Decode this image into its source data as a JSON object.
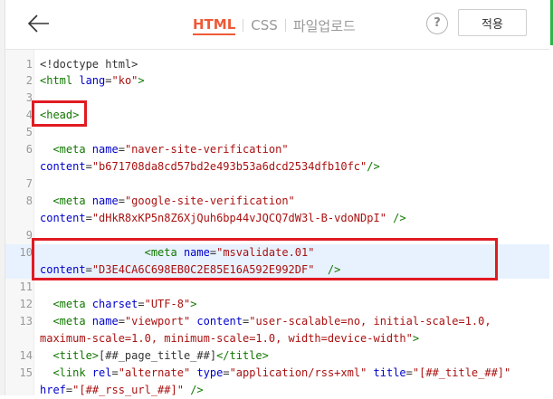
{
  "header": {
    "tabs": [
      {
        "label": "HTML",
        "active": true
      },
      {
        "label": "CSS",
        "active": false
      },
      {
        "label": "파일업로드",
        "active": false
      }
    ],
    "help_label": "?",
    "apply_label": "적용"
  },
  "editor": {
    "line_numbers": [
      "1",
      "2",
      "3",
      "4",
      "5",
      "6",
      "7",
      "8",
      "9",
      "10",
      "11",
      "12",
      "13",
      "14",
      "15"
    ],
    "code": {
      "l1": "<!doctype html>",
      "l2_open": "<html ",
      "l2_attr": "lang",
      "l2_eq": "=",
      "l2_val": "\"ko\"",
      "l2_close": ">",
      "l4": "<head>",
      "l6_open": "  <meta ",
      "l6_attr": "name",
      "l6_eq": "=",
      "l6_val": "\"naver-site-verification\"",
      "l6b_attr": "content",
      "l6b_eq": "=",
      "l6b_val": "\"b671708da8cd57bd2e493b53a6dcd2534dfb10fc\"",
      "l6b_close": "/>",
      "l8_open": "  <meta ",
      "l8_attr": "name",
      "l8_eq": "=",
      "l8_val": "\"google-site-verification\"",
      "l8b_attr": "content",
      "l8b_eq": "=",
      "l8b_val": "\"dHkR8xKP5n8Z6XjQuh6bp44vJQCQ7dW3l-B-vdoNDpI\"",
      "l8b_close": " />",
      "l10_open": "                <meta ",
      "l10_attr": "name",
      "l10_eq": "=",
      "l10_val": "\"msvalidate.01\"",
      "l10b_attr": "content",
      "l10b_eq": "=",
      "l10b_val": "\"D3E4CA6C698EB0C2E85E16A592E992DF\"",
      "l10b_close": "  />",
      "l12_open": "  <meta ",
      "l12_attr": "charset",
      "l12_eq": "=",
      "l12_val": "\"UTF-8\"",
      "l12_close": ">",
      "l13_open": "  <meta ",
      "l13_attr1": "name",
      "l13_eq1": "=",
      "l13_val1": "\"viewport\"",
      "l13_sp": " ",
      "l13_attr2": "content",
      "l13_eq2": "=",
      "l13_val2a": "\"user-scalable=no, initial-scale=1.0,",
      "l13b_val2b": "maximum-scale=1.0, minimum-scale=1.0, width=device-width\"",
      "l13b_close": ">",
      "l14_open": "  <title>",
      "l14_text": "[##_page_title_##]",
      "l14_close": "</title>",
      "l15_open": "  <link ",
      "l15_attr1": "rel",
      "l15_eq1": "=",
      "l15_val1": "\"alternate\"",
      "l15_attr2": "type",
      "l15_eq2": "=",
      "l15_val2": "\"application/rss+xml\"",
      "l15_attr3": "title",
      "l15_eq3": "=",
      "l15_val3": "\"[##_title_##]\"",
      "l15b_attr": "href",
      "l15b_eq": "=",
      "l15b_val": "\"[##_rss_url_##]\"",
      "l15b_close": " />"
    }
  }
}
